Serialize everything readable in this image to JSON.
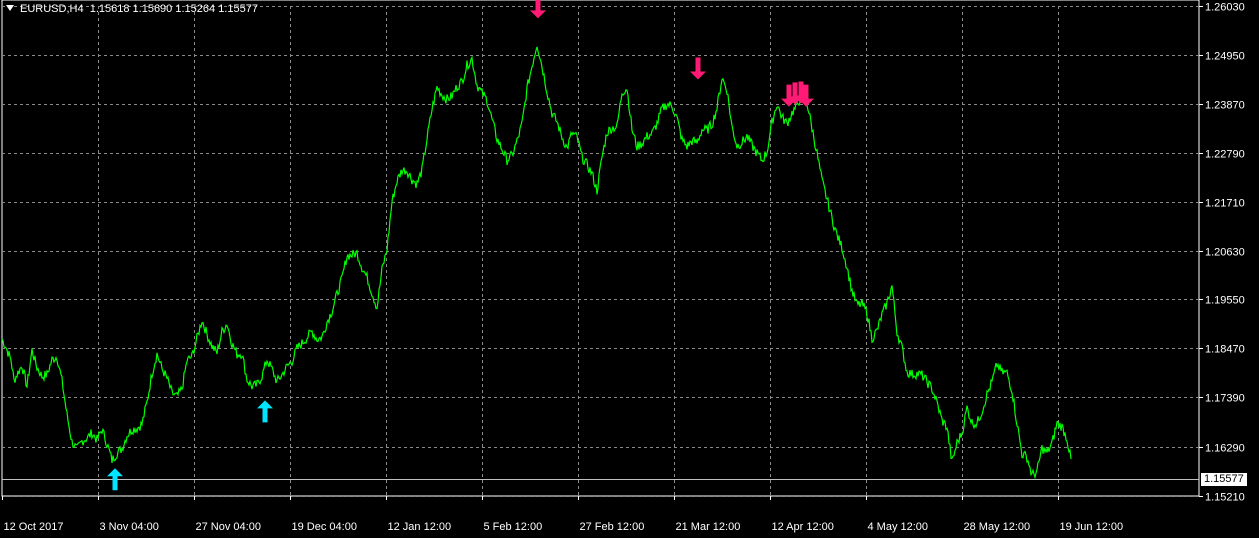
{
  "header": {
    "symbol": "EURUSD,H4",
    "open": "1.15618",
    "high": "1.15690",
    "low": "1.15264",
    "close": "1.15577"
  },
  "colors": {
    "background": "#000000",
    "grid": "#8a8a8a",
    "price_line": "#00ff00",
    "buy_arrow": "#00e5ff",
    "sell_arrow": "#ff1a75",
    "text": "#ffffff"
  },
  "chart_data": {
    "type": "line",
    "symbol": "EURUSD",
    "timeframe": "H4",
    "y_ticks": [
      "1.26030",
      "1.24950",
      "1.23870",
      "1.22790",
      "1.21710",
      "1.20630",
      "1.19550",
      "1.18470",
      "1.17390",
      "1.16290",
      "1.15210"
    ],
    "ylim": [
      1.1521,
      1.2603
    ],
    "x_ticks": [
      "12 Oct 2017",
      "3 Nov 04:00",
      "27 Nov 04:00",
      "19 Dec 04:00",
      "12 Jan 12:00",
      "5 Feb 12:00",
      "27 Feb 12:00",
      "21 Mar 12:00",
      "12 Apr 12:00",
      "4 May 12:00",
      "28 May 12:00",
      "19 Jun 12:00"
    ],
    "current_price": "1.15577",
    "grid": true,
    "series": [
      {
        "x_index": [
          0,
          3,
          6,
          9,
          12,
          16,
          20,
          25,
          30,
          35,
          40,
          45,
          50,
          55,
          60,
          65,
          70,
          75,
          80,
          85,
          90,
          95,
          100,
          105,
          110,
          115,
          120,
          125,
          130,
          135,
          140,
          145,
          150,
          155,
          160,
          165,
          170,
          175,
          180,
          185,
          190,
          195,
          200,
          205,
          210,
          215,
          220,
          225,
          230,
          235,
          240,
          245,
          250,
          255,
          260,
          265,
          270,
          275,
          280,
          285,
          290,
          295,
          300,
          305,
          310,
          315,
          320,
          325,
          330,
          335,
          340,
          345,
          350,
          355,
          360,
          365,
          370,
          375,
          380,
          385,
          390,
          395,
          400,
          405,
          410,
          415,
          420,
          425,
          430,
          435,
          440,
          445,
          450,
          455,
          460,
          465,
          470,
          475,
          480,
          485,
          490,
          495,
          500,
          505,
          510,
          515,
          520,
          525,
          530,
          535,
          540,
          545,
          550,
          555,
          560,
          565,
          570,
          575,
          580,
          585,
          590,
          595,
          600,
          605,
          610,
          615,
          620,
          625,
          630,
          635,
          640,
          645,
          650,
          655,
          660,
          665,
          670,
          675,
          680,
          685,
          690,
          695,
          700,
          705,
          710,
          715,
          720,
          725,
          730,
          735,
          740,
          745,
          750,
          755,
          760,
          765,
          770,
          775,
          780,
          785,
          790,
          795,
          800,
          805,
          810,
          815,
          820,
          825,
          830,
          835,
          840,
          845,
          850,
          855,
          860,
          865,
          870,
          875,
          880,
          885,
          890,
          895,
          900,
          905,
          910,
          915,
          920,
          925,
          930,
          935,
          940,
          945,
          950,
          955,
          960,
          965,
          970,
          975,
          980,
          985,
          990,
          995,
          1000,
          1005,
          1010,
          1015,
          1020,
          1025,
          1030,
          1035,
          1040,
          1045,
          1050,
          1055,
          1060,
          1065,
          1070,
          1075,
          1080,
          1085,
          1090,
          1095,
          1100
        ],
        "values": [
          1.1867,
          1.1855,
          1.1838,
          1.1822,
          1.1776,
          1.1794,
          1.1809,
          1.1763,
          1.1843,
          1.1805,
          1.1785,
          1.1789,
          1.1822,
          1.1829,
          1.1775,
          1.17,
          1.164,
          1.1624,
          1.1642,
          1.1649,
          1.166,
          1.1645,
          1.1668,
          1.1637,
          1.16,
          1.1616,
          1.1626,
          1.1655,
          1.1668,
          1.1671,
          1.168,
          1.1728,
          1.1792,
          1.1835,
          1.1802,
          1.1781,
          1.1748,
          1.174,
          1.1758,
          1.182,
          1.1829,
          1.1869,
          1.191,
          1.1878,
          1.1852,
          1.1837,
          1.1884,
          1.1902,
          1.1858,
          1.1834,
          1.1836,
          1.1778,
          1.1763,
          1.1766,
          1.1786,
          1.1822,
          1.1801,
          1.1773,
          1.1789,
          1.1807,
          1.1819,
          1.1847,
          1.1858,
          1.1871,
          1.1885,
          1.1867,
          1.1872,
          1.1905,
          1.193,
          1.1966,
          1.2001,
          1.2052,
          1.2053,
          1.2058,
          1.2026,
          1.2004,
          1.197,
          1.1937,
          1.202,
          1.2066,
          1.2171,
          1.2217,
          1.2241,
          1.224,
          1.222,
          1.221,
          1.224,
          1.231,
          1.2375,
          1.2424,
          1.2407,
          1.2397,
          1.2404,
          1.2425,
          1.2437,
          1.2472,
          1.2487,
          1.2429,
          1.241,
          1.2396,
          1.2352,
          1.231,
          1.2287,
          1.2263,
          1.2273,
          1.2304,
          1.2342,
          1.242,
          1.2471,
          1.252,
          1.2471,
          1.2416,
          1.2366,
          1.2347,
          1.2314,
          1.2289,
          1.2322,
          1.2313,
          1.2269,
          1.2252,
          1.2233,
          1.2195,
          1.2269,
          1.2324,
          1.2334,
          1.2336,
          1.2413,
          1.2422,
          1.2331,
          1.2292,
          1.23,
          1.2315,
          1.2321,
          1.2343,
          1.2376,
          1.2386,
          1.2383,
          1.2355,
          1.2307,
          1.2293,
          1.2305,
          1.2301,
          1.233,
          1.2329,
          1.2342,
          1.2378,
          1.2445,
          1.2418,
          1.2336,
          1.2294,
          1.2302,
          1.2315,
          1.2295,
          1.2278,
          1.2262,
          1.2281,
          1.2346,
          1.2387,
          1.2357,
          1.2344,
          1.2367,
          1.2382,
          1.2411,
          1.239,
          1.2334,
          1.2278,
          1.2217,
          1.2177,
          1.2134,
          1.2097,
          1.207,
          1.2027,
          1.1974,
          1.1943,
          1.1945,
          1.1926,
          1.1869,
          1.1886,
          1.1921,
          1.1947,
          1.1985,
          1.1884,
          1.1848,
          1.1795,
          1.179,
          1.1791,
          1.1788,
          1.1773,
          1.1758,
          1.1727,
          1.1688,
          1.1673,
          1.1595,
          1.1638,
          1.166,
          1.1716,
          1.1683,
          1.1681,
          1.1709,
          1.1745,
          1.1773,
          1.1812,
          1.1794,
          1.1793,
          1.1755,
          1.1682,
          1.1614,
          1.1607,
          1.1567,
          1.1574,
          1.1627,
          1.1616,
          1.1637,
          1.1682,
          1.1674,
          1.1648,
          1.1587
        ]
      }
    ],
    "arrows": [
      {
        "kind": "buy",
        "x_index": 113,
        "value": 1.1558
      },
      {
        "kind": "buy",
        "x_index": 263,
        "value": 1.1708
      },
      {
        "kind": "sell",
        "x_index": 536,
        "value": 1.26
      },
      {
        "kind": "sell",
        "x_index": 696,
        "value": 1.2465
      },
      {
        "kind": "sell",
        "x_index": 787,
        "value": 1.2405
      },
      {
        "kind": "sell",
        "x_index": 793,
        "value": 1.241
      },
      {
        "kind": "sell",
        "x_index": 799,
        "value": 1.2412
      },
      {
        "kind": "sell",
        "x_index": 804,
        "value": 1.2405
      }
    ]
  }
}
